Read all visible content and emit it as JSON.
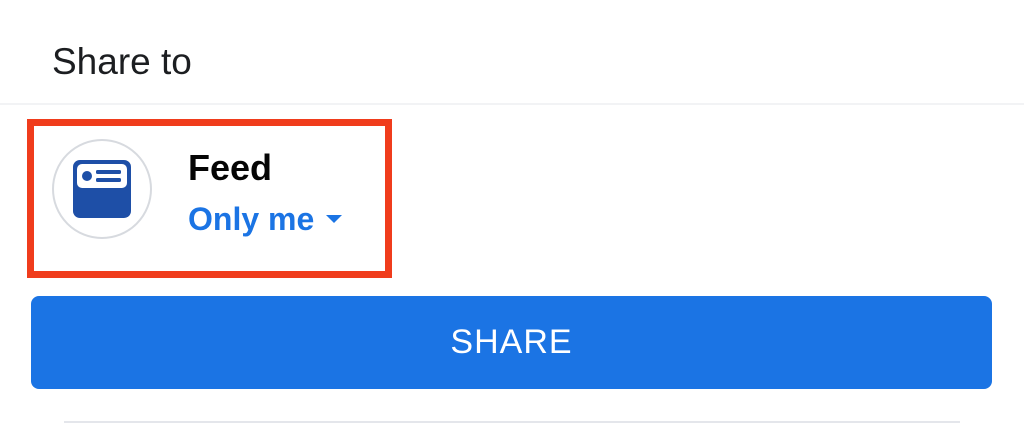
{
  "header": {
    "title": "Share to"
  },
  "audience": {
    "destination_label": "Feed",
    "destination_icon": "feed-icon",
    "privacy_label": "Only me",
    "privacy_icon": "caret-down-icon"
  },
  "actions": {
    "share_label": "SHARE"
  },
  "colors": {
    "accent": "#1b74e4",
    "highlight": "#f03c1c",
    "icon_blue": "#1e4fa7"
  }
}
